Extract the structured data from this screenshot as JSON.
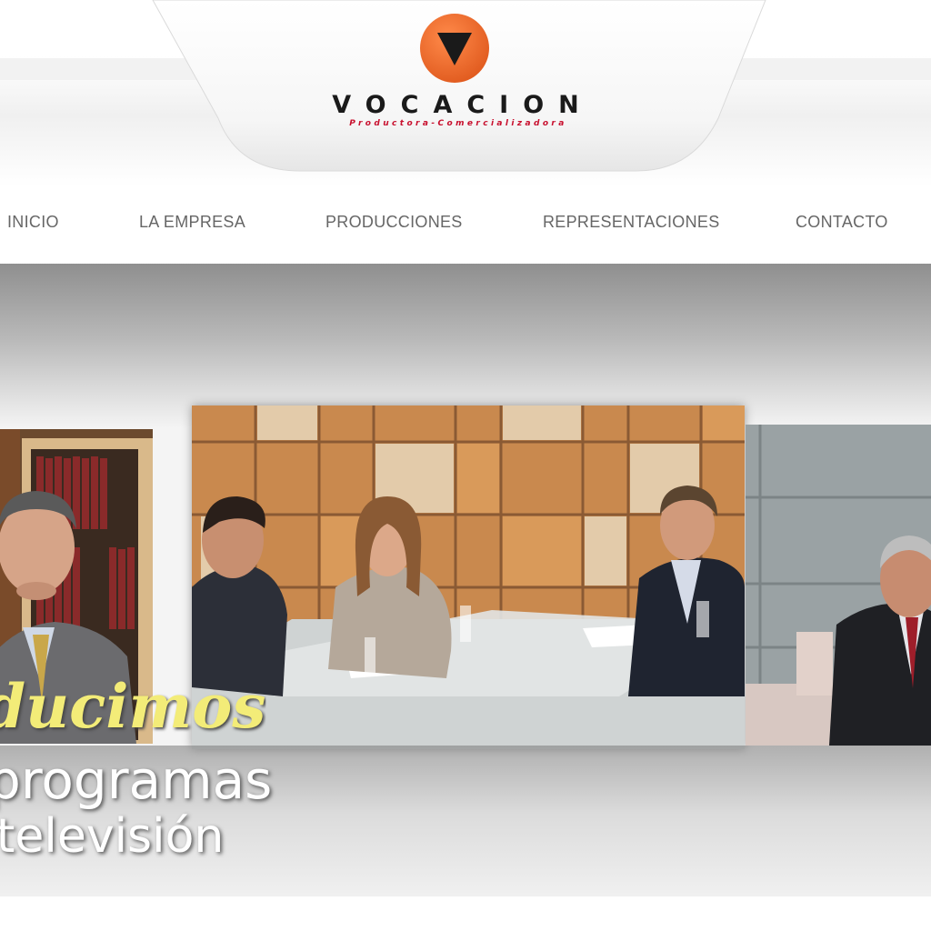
{
  "brand": {
    "name": "VOCACION",
    "tagline": "Productora-Comercializadora",
    "circle_color": "#ee6a2b",
    "triangle_color": "#1a1a1a"
  },
  "nav": {
    "items": [
      {
        "label": "INICIO"
      },
      {
        "label": "LA EMPRESA"
      },
      {
        "label": "PRODUCCIONES"
      },
      {
        "label": "REPRESENTACIONES"
      },
      {
        "label": "CONTACTO"
      }
    ]
  },
  "banner": {
    "slogan_line1": "ducimos",
    "slogan_line2": "programas",
    "slogan_line3": "televisión",
    "slogan_color": "#f3ec78"
  }
}
